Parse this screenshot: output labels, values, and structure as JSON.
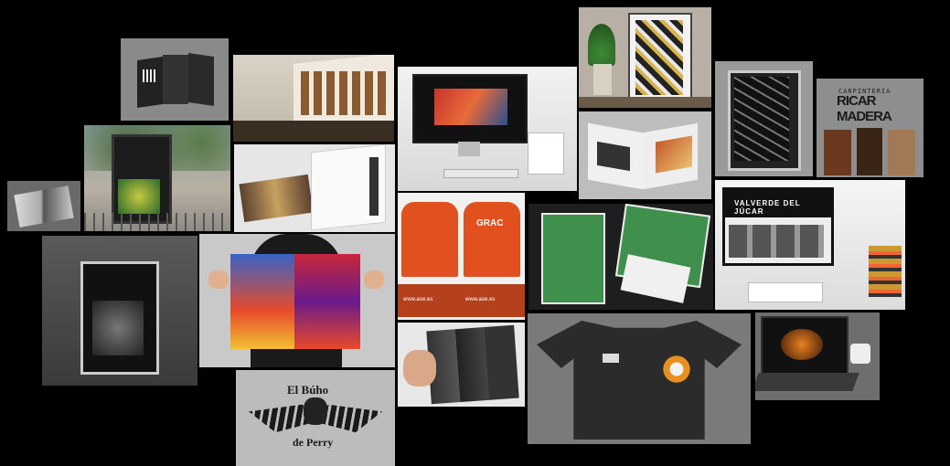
{
  "tiles": {
    "ricar": {
      "line1": "CARPINTERIA",
      "line2": "RICAR MADERA"
    },
    "valverde": {
      "banner": "VALVERDE DEL JÚCAR"
    },
    "buho": {
      "line1": "El Búho",
      "line2": "de Perry"
    },
    "tshirt_orange": {
      "front_text": "www.aoe.es",
      "back_text": "www.aoe.es"
    },
    "crest_text": "GRAC"
  },
  "colors": {
    "background": "#000000",
    "tile_gray": "#7a7a7a",
    "orange": "#e0511f",
    "green": "#3f8f4d",
    "dark_shirt": "#2b2b2b"
  }
}
